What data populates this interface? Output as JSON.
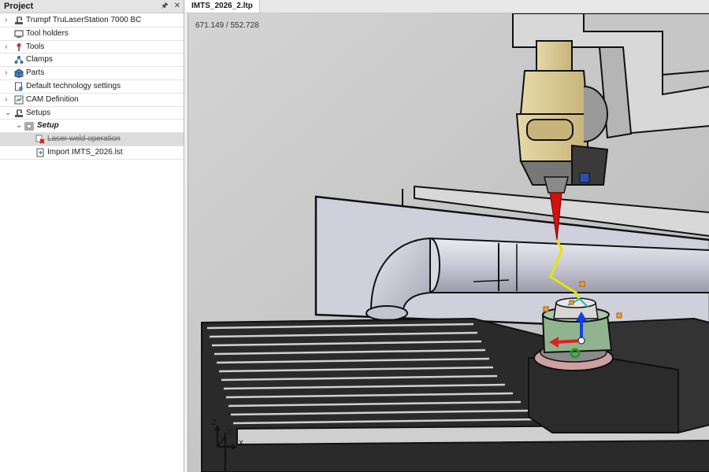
{
  "panel": {
    "title": "Project"
  },
  "tree": {
    "machine": "Trumpf TruLaserStation 7000 BC",
    "tool_holders": "Tool holders",
    "tools": "Tools",
    "clamps": "Clamps",
    "parts": "Parts",
    "default_tech": "Default technology settings",
    "cam_definition": "CAM Definition",
    "setups": "Setups",
    "setup": "Setup",
    "laser_weld": "Laser weld operation",
    "import": "Import IMTS_2026.lst"
  },
  "tab": {
    "label": "IMTS_2026_2.ltp"
  },
  "viewport": {
    "coordinates": "671.149 / 552.728",
    "axis_x": "X",
    "axis_y": "Y",
    "axis_z": "Z"
  },
  "colors": {
    "laser_beam": "#d41010",
    "weld_path": "#e6e600",
    "gizmo_x": "#e02020",
    "gizmo_y": "#20a020",
    "gizmo_z": "#1a3fe0",
    "gizmo_handle": "#f0a030"
  },
  "icons": {
    "machine": "machine-icon",
    "tool_holder": "tool-holder-icon",
    "tool": "tool-icon",
    "clamp": "clamp-icon",
    "part": "part-icon",
    "settings": "settings-icon",
    "cam": "cam-icon",
    "setup": "setup-icon",
    "error": "error-icon",
    "import": "import-icon"
  }
}
